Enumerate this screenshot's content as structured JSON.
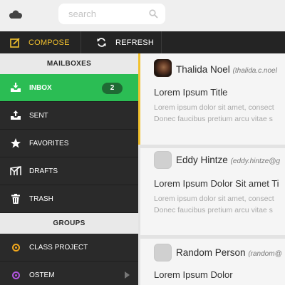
{
  "search": {
    "placeholder": "search"
  },
  "toolbar": {
    "compose_label": "COMPOSE",
    "refresh_label": "REFRESH"
  },
  "sidebar": {
    "mailboxes_heading": "MAILBOXES",
    "items": [
      {
        "label": "INBOX",
        "badge": "2",
        "icon": "inbox-icon"
      },
      {
        "label": "SENT",
        "icon": "sent-icon"
      },
      {
        "label": "FAVORITES",
        "icon": "star-icon"
      },
      {
        "label": "DRAFTS",
        "icon": "drafts-icon"
      },
      {
        "label": "TRASH",
        "icon": "trash-icon"
      }
    ],
    "groups_heading": "GROUPS",
    "groups": [
      {
        "label": "CLASS PROJECT",
        "color": "#f2a81d"
      },
      {
        "label": "OSTEM",
        "color": "#b255e0"
      }
    ]
  },
  "messages": [
    {
      "sender": "Thalida Noel",
      "email": "(thalida.c.noel",
      "subject": "Lorem Ipsum Title",
      "preview_1": "Lorem ipsum dolor sit amet, consect",
      "preview_2": "Donec faucibus pretium arcu vitae s"
    },
    {
      "sender": "Eddy Hintze",
      "email": "(eddy.hintze@g",
      "subject": "Lorem Ipsum Dolor Sit amet Ti",
      "preview_1": "Lorem ipsum dolor sit amet, consect",
      "preview_2": "Donec faucibus pretium arcu vitae s"
    },
    {
      "sender": "Random Person",
      "email": "(random@",
      "subject": "Lorem Ipsum Dolor",
      "preview_1": "",
      "preview_2": ""
    }
  ],
  "colors": {
    "accent": "#f2c12e",
    "active": "#2bbd54",
    "sidebar": "#2a2a2a"
  }
}
